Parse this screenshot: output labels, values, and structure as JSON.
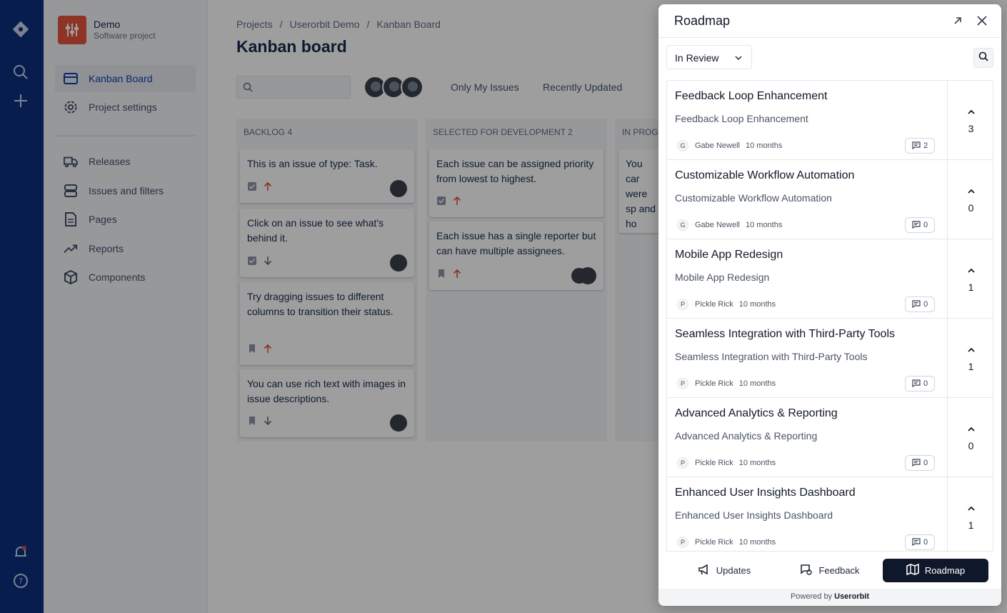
{
  "sidebar": {
    "project_name": "Demo",
    "project_type": "Software project",
    "items": [
      {
        "label": "Kanban Board",
        "icon": "board-icon"
      },
      {
        "label": "Project settings",
        "icon": "gear-icon"
      },
      {
        "label": "Releases",
        "icon": "truck-icon"
      },
      {
        "label": "Issues and filters",
        "icon": "stack-icon"
      },
      {
        "label": "Pages",
        "icon": "page-icon"
      },
      {
        "label": "Reports",
        "icon": "trend-icon"
      },
      {
        "label": "Components",
        "icon": "box-icon"
      }
    ]
  },
  "main": {
    "breadcrumbs": [
      "Projects",
      "Userorbit Demo",
      "Kanban Board"
    ],
    "title": "Kanban board",
    "filters": [
      "Only My Issues",
      "Recently Updated"
    ],
    "columns": [
      {
        "title": "Backlog 4",
        "cards": [
          {
            "text": "This is an issue of type: Task."
          },
          {
            "text": "Click on an issue to see what's behind it."
          },
          {
            "text": "Try dragging issues to different columns to transition their status."
          },
          {
            "text": "You can use rich text with images in issue descriptions."
          }
        ]
      },
      {
        "title": "Selected for Development 2",
        "cards": [
          {
            "text": "Each issue can be assigned priority from lowest to highest."
          },
          {
            "text": "Each issue has a single reporter but can have multiple assignees."
          }
        ]
      },
      {
        "title": "In Progr",
        "cards": [
          {
            "text": "You car were sp and ho"
          }
        ]
      }
    ]
  },
  "widget": {
    "title": "Roadmap",
    "status_filter": "In Review",
    "items": [
      {
        "title": "Feedback Loop Enhancement",
        "description": "Feedback Loop Enhancement",
        "initial": "G",
        "author": "Gabe Newell",
        "age": "10 months",
        "comments": "2",
        "votes": "3"
      },
      {
        "title": "Customizable Workflow Automation",
        "description": "Customizable Workflow Automation",
        "initial": "G",
        "author": "Gabe Newell",
        "age": "10 months",
        "comments": "0",
        "votes": "0"
      },
      {
        "title": "Mobile App Redesign",
        "description": "Mobile App Redesign",
        "initial": "P",
        "author": "Pickle Rick",
        "age": "10 months",
        "comments": "0",
        "votes": "1"
      },
      {
        "title": "Seamless Integration with Third-Party Tools",
        "description": "Seamless Integration with Third-Party Tools",
        "initial": "P",
        "author": "Pickle Rick",
        "age": "10 months",
        "comments": "0",
        "votes": "1"
      },
      {
        "title": "Advanced Analytics & Reporting",
        "description": "Advanced Analytics & Reporting",
        "initial": "P",
        "author": "Pickle Rick",
        "age": "10 months",
        "comments": "0",
        "votes": "0"
      },
      {
        "title": "Enhanced User Insights Dashboard",
        "description": "Enhanced User Insights Dashboard",
        "initial": "P",
        "author": "Pickle Rick",
        "age": "10 months",
        "comments": "0",
        "votes": "1"
      }
    ],
    "tabs": [
      {
        "label": "Updates",
        "icon": "megaphone-icon"
      },
      {
        "label": "Feedback",
        "icon": "chat-icon"
      },
      {
        "label": "Roadmap",
        "icon": "map-icon"
      }
    ],
    "powered_prefix": "Powered by",
    "powered_brand": "Userorbit"
  },
  "colors": {
    "global_nav": "#0b2f7f",
    "priority_high": "#e5493a",
    "active_tab": "#0f172a"
  }
}
